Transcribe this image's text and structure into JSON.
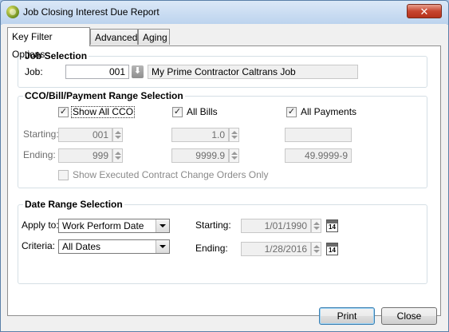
{
  "window": {
    "title": "Job Closing Interest Due Report",
    "close_glyph": "✕"
  },
  "tabs": [
    {
      "label": "Key Filter Options",
      "active": true
    },
    {
      "label": "Advanced",
      "active": false
    },
    {
      "label": "Aging",
      "active": false
    }
  ],
  "job_selection": {
    "title": "Job Selection",
    "job_label": "Job:",
    "job_number": "001",
    "job_name": "My Prime Contractor Caltrans Job",
    "lookup_icon": "arrow-down-icon"
  },
  "range_selection": {
    "title": "CCO/Bill/Payment Range Selection",
    "show_all_cco_label": "Show All CCO",
    "show_all_cco_checked": true,
    "all_bills_label": "All Bills",
    "all_bills_checked": true,
    "all_payments_label": "All Payments",
    "all_payments_checked": true,
    "starting_label": "Starting:",
    "ending_label": "Ending:",
    "cco_start": "001",
    "cco_end": "999",
    "bill_start": "1.0",
    "bill_end": "9999.9",
    "payment_start": "",
    "payment_end": "49.9999-9",
    "show_executed_label": "Show Executed Contract Change Orders Only",
    "show_executed_checked": false
  },
  "date_range": {
    "title": "Date Range Selection",
    "apply_to_label": "Apply to:",
    "apply_to_value": "Work Perform Date",
    "criteria_label": "Criteria:",
    "criteria_value": "All Dates",
    "starting_label": "Starting:",
    "starting_value": "1/01/1990",
    "ending_label": "Ending:",
    "ending_value": "1/28/2016",
    "calendar_day": "14"
  },
  "buttons": {
    "print": "Print",
    "close": "Close"
  }
}
